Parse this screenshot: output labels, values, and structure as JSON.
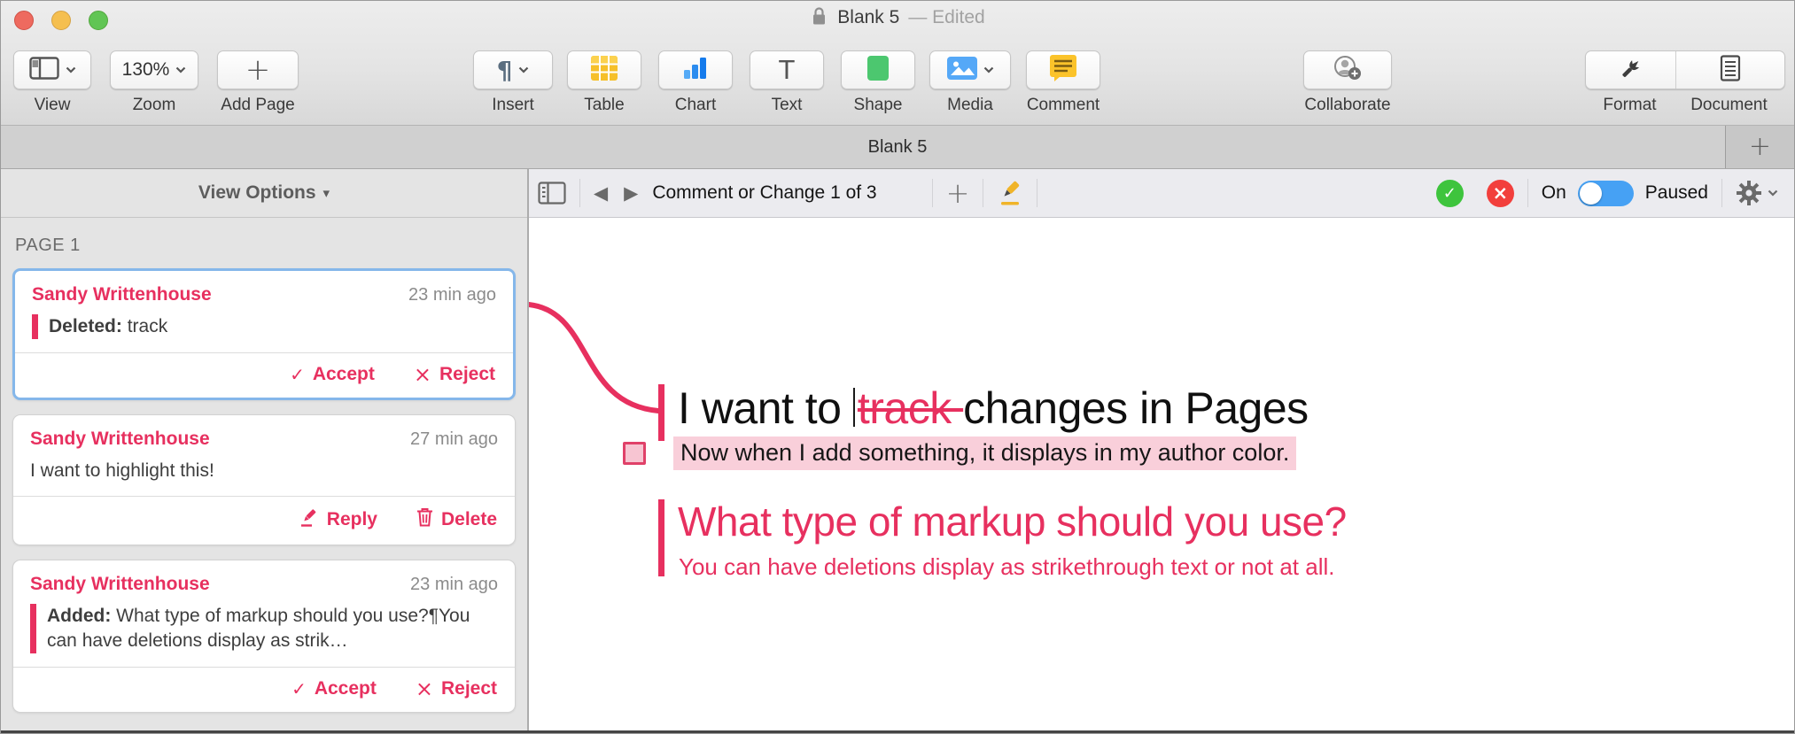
{
  "window": {
    "title": "Blank 5",
    "edited_suffix": "— Edited",
    "tab_title": "Blank 5"
  },
  "icons": {
    "check": "✓",
    "cross": "×",
    "back": "◀",
    "forward": "▶",
    "plus": "+",
    "pilcrow": "¶",
    "text_tool": "T",
    "caret_down": "▾"
  },
  "toolbar": {
    "view_label": "View",
    "zoom_value": "130%",
    "zoom_label": "Zoom",
    "add_page_label": "Add Page",
    "insert_label": "Insert",
    "table_label": "Table",
    "chart_label": "Chart",
    "text_label": "Text",
    "shape_label": "Shape",
    "media_label": "Media",
    "comment_label": "Comment",
    "collaborate_label": "Collaborate",
    "format_label": "Format",
    "document_label": "Document"
  },
  "sidebar": {
    "view_options_label": "View Options",
    "page_label": "PAGE 1",
    "cards": [
      {
        "author": "Sandy Writtenhouse",
        "time": "23 min ago",
        "change_label": "Deleted:",
        "change_text": " track",
        "accept_label": "Accept",
        "reject_label": "Reject"
      },
      {
        "author": "Sandy Writtenhouse",
        "time": "27 min ago",
        "body": "I want to highlight this!",
        "reply_label": "Reply",
        "delete_label": "Delete"
      },
      {
        "author": "Sandy Writtenhouse",
        "time": "23 min ago",
        "change_label": "Added:",
        "change_text": " What type of markup should you use?¶You can have deletions display as strik…",
        "accept_label": "Accept",
        "reject_label": "Reject"
      }
    ]
  },
  "review_bar": {
    "counter": "Comment or Change 1 of 3",
    "on_label": "On",
    "paused_label": "Paused"
  },
  "document": {
    "heading1_pre": "I want to ",
    "deleted_word": "track ",
    "heading1_post": "changes in Pages",
    "highlighted_sentence": "Now when I add something, it displays in my author color.",
    "heading2": "What type of markup should you use?",
    "subheading2": "You can have deletions display as strikethrough text or not at all."
  },
  "colors": {
    "accent_pink": "#e7305f",
    "highlight_pink": "#f9cfda",
    "selection_blue": "#85b7ea",
    "toggle_blue": "#46a1f4",
    "accept_green": "#3ec43d",
    "reject_red": "#f23f3c"
  }
}
